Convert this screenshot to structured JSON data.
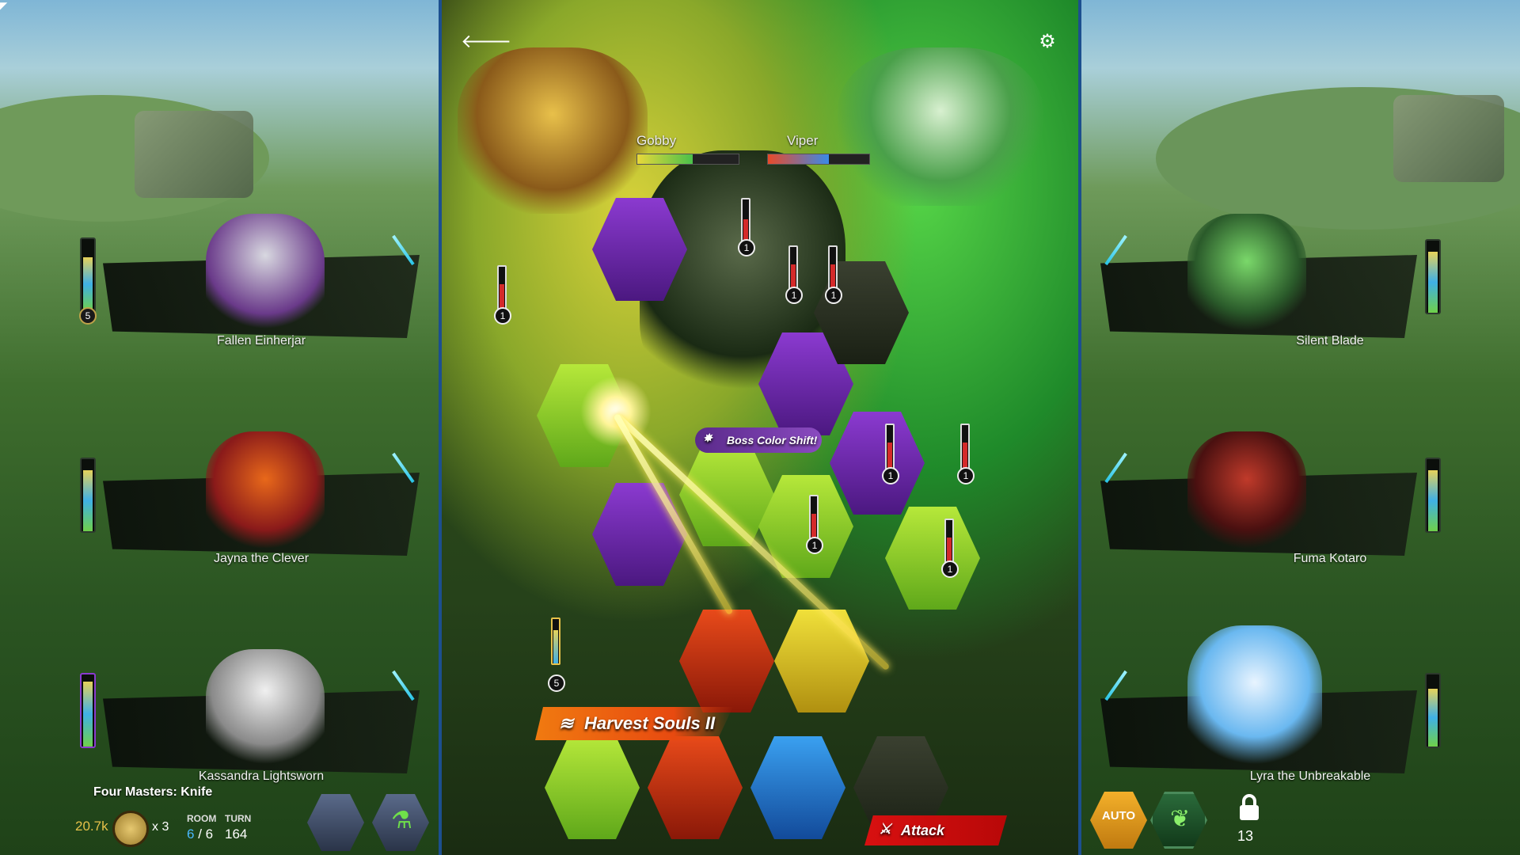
{
  "top_bar": {
    "back_icon": "back-arrow-icon",
    "settings_icon": "gear-icon"
  },
  "boss": {
    "left_name": "Gobby",
    "right_name": "Viper",
    "left_hp": 0.55,
    "right_hp": 0.6
  },
  "left_party": [
    {
      "name": "Fallen Einherjar",
      "meter_level": 0.75,
      "badge": "5",
      "accent": "#8a3ad0"
    },
    {
      "name": "Jayna the Clever",
      "meter_level": 0.85,
      "badge": "",
      "accent": "#d42a2a"
    },
    {
      "name": "Kassandra Lightsworn",
      "meter_level": 0.9,
      "badge": "",
      "accent": "#e6c14a"
    }
  ],
  "right_party": [
    {
      "name": "Silent Blade",
      "meter_level": 0.85,
      "accent": "#4ac04a"
    },
    {
      "name": "Fuma Kotaro",
      "meter_level": 0.85,
      "accent": "#c02a2a"
    },
    {
      "name": "Lyra the Unbreakable",
      "meter_level": 0.8,
      "accent": "#6ab8f0"
    }
  ],
  "board": {
    "banners": {
      "harvest": "Harvest Souls II",
      "attack": "Attack",
      "boss_shift": "Boss Color Shift!"
    },
    "unit_numbers": [
      "1",
      "1",
      "1",
      "1",
      "1",
      "1",
      "1",
      "1",
      "5"
    ]
  },
  "hud": {
    "dungeon": "Four Masters: Knife",
    "gold": "20.7k",
    "coin_count": "x 3",
    "room_label": "ROOM",
    "room_current": "6",
    "room_sep": " / ",
    "room_total": "6",
    "turn_label": "TURN",
    "turn_value": "164",
    "auto_label": "AUTO",
    "lock_count": "13"
  }
}
